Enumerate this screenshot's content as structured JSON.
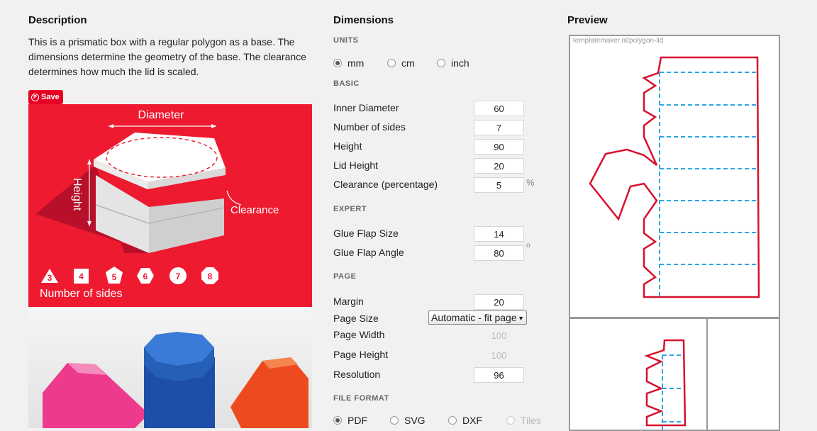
{
  "description": {
    "heading": "Description",
    "text": "This is a prismatic box with a regular polygon as a base. The dimensions determine the geometry of the base. The clearance determines how much the lid is scaled.",
    "pin_save_label": "Save",
    "illustration": {
      "diameter_label": "Diameter",
      "height_label": "Height",
      "clearance_label": "Clearance",
      "sides_label": "Number of sides",
      "side_counts": [
        "3",
        "4",
        "5",
        "6",
        "7",
        "8"
      ]
    }
  },
  "dimensions": {
    "heading": "Dimensions",
    "units": {
      "label": "UNITS",
      "options": [
        "mm",
        "cm",
        "inch"
      ],
      "selected": "mm"
    },
    "basic": {
      "label": "BASIC",
      "fields": [
        {
          "label": "Inner Diameter",
          "value": "60"
        },
        {
          "label": "Number of sides",
          "value": "7"
        },
        {
          "label": "Height",
          "value": "90"
        },
        {
          "label": "Lid Height",
          "value": "20"
        },
        {
          "label": "Clearance (percentage)",
          "value": "5",
          "unit": "%"
        }
      ]
    },
    "expert": {
      "label": "EXPERT",
      "fields": [
        {
          "label": "Glue Flap Size",
          "value": "14"
        },
        {
          "label": "Glue Flap Angle",
          "value": "80",
          "unit": "o"
        }
      ]
    },
    "page": {
      "label": "PAGE",
      "margin": {
        "label": "Margin",
        "value": "20"
      },
      "page_size": {
        "label": "Page Size",
        "selected": "Automatic - fit page"
      },
      "page_width": {
        "label": "Page Width",
        "value": "100"
      },
      "page_height": {
        "label": "Page Height",
        "value": "100"
      },
      "resolution": {
        "label": "Resolution",
        "value": "96"
      }
    },
    "file_format": {
      "label": "FILE FORMAT",
      "options": [
        "PDF",
        "SVG",
        "DXF",
        "Tiles"
      ],
      "selected": "PDF"
    }
  },
  "preview": {
    "heading": "Preview",
    "sheet_caption": "templatemaker.nl/polygon-lid"
  },
  "colors": {
    "brand_red": "#ee1a30",
    "cut_line": "#d8102c",
    "fold_line": "#2ba6e8"
  }
}
